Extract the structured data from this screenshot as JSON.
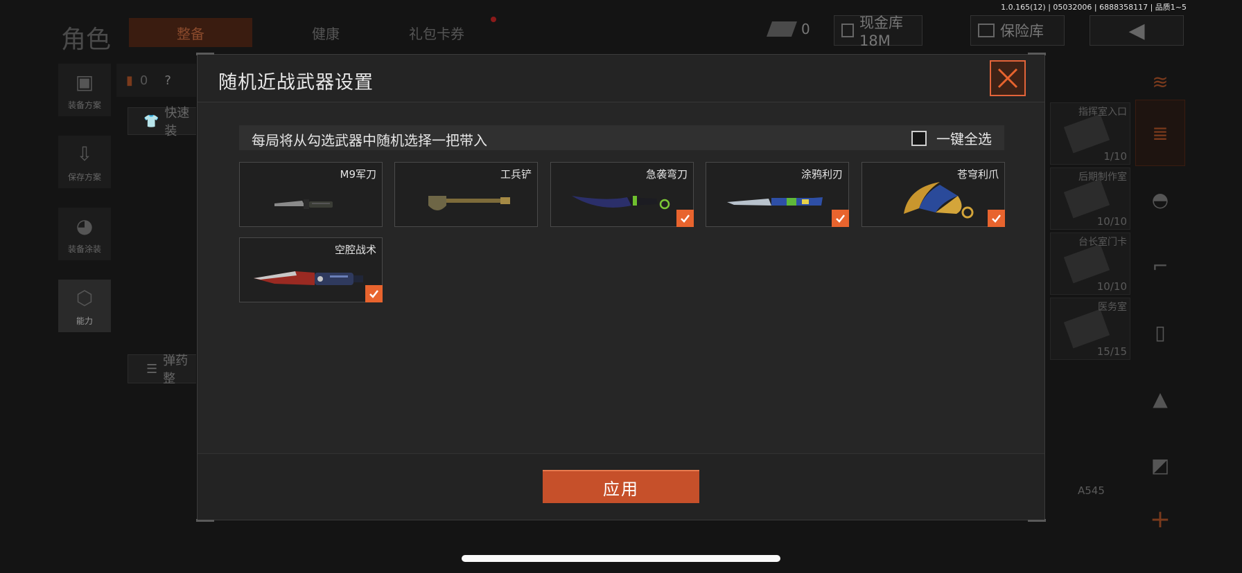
{
  "version_info": "1.0.165(12) | 05032006 | 6888358117 | 品质1~5",
  "background": {
    "page_title": "角色",
    "tabs": [
      "整备",
      "健康",
      "礼包卡券"
    ],
    "cash_count": "0",
    "cash_vault_label": "现金库 18M",
    "safe_label": "保险库",
    "orange_count": "0",
    "help_glyph": "?",
    "left_items": [
      "装备方案",
      "保存方案",
      "装备涂装",
      "能力"
    ],
    "quick_button": "快速装",
    "ammo_button": "弹药整",
    "keycards": [
      {
        "name": "指挥室入口",
        "count": "1/10"
      },
      {
        "name": "后期制作室",
        "count": "10/10"
      },
      {
        "name": "台长室门卡",
        "count": "10/10"
      },
      {
        "name": "医务室",
        "count": "15/15"
      }
    ],
    "weapon_label": "A545"
  },
  "modal": {
    "title": "随机近战武器设置",
    "notice": "每局将从勾选武器中随机选择一把带入",
    "select_all_label": "一键全选",
    "select_all_checked": false,
    "apply_label": "应用",
    "weapons": [
      {
        "name": "M9军刀",
        "checked": false,
        "art": "bayonet"
      },
      {
        "name": "工兵铲",
        "checked": false,
        "art": "shovel"
      },
      {
        "name": "急袭弯刀",
        "checked": true,
        "art": "karambit"
      },
      {
        "name": "涂鸦利刃",
        "checked": true,
        "art": "graffiti-blade"
      },
      {
        "name": "苍穹利爪",
        "checked": true,
        "art": "golden-claw"
      },
      {
        "name": "空腔战术",
        "checked": true,
        "art": "red-tactical-knife"
      }
    ]
  },
  "colors": {
    "accent": "#e8642e",
    "modal_bg": "#262626",
    "apply_bg": "#c6502a"
  }
}
